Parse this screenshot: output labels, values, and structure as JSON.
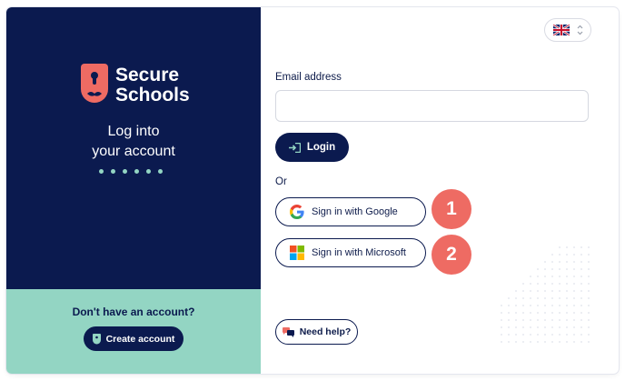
{
  "brand": {
    "name_line1": "Secure",
    "name_line2": "Schools",
    "tagline_line1": "Log into",
    "tagline_line2": "your account"
  },
  "colors": {
    "navy": "#0b1a4f",
    "mint": "#93d5c3",
    "coral": "#ee6b63"
  },
  "language": {
    "icon": "uk-flag-icon"
  },
  "form": {
    "email_label": "Email address",
    "email_value": "",
    "email_placeholder": "",
    "login_label": "Login",
    "or_label": "Or",
    "google_label": "Sign in with Google",
    "microsoft_label": "Sign in with Microsoft",
    "help_label": "Need help?"
  },
  "signup": {
    "prompt": "Don't have an account?",
    "button_label": "Create account"
  },
  "badges": [
    "1",
    "2"
  ]
}
